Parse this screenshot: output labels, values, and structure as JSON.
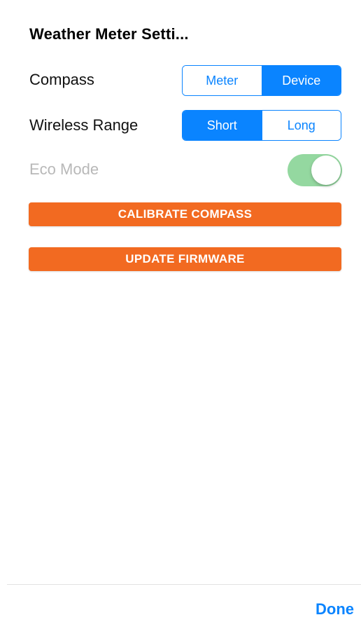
{
  "header": {
    "title": "Weather Meter Setti..."
  },
  "settings": {
    "compass": {
      "label": "Compass",
      "options": [
        "Meter",
        "Device"
      ],
      "selected": "Device"
    },
    "wireless_range": {
      "label": "Wireless Range",
      "options": [
        "Short",
        "Long"
      ],
      "selected": "Short"
    },
    "eco_mode": {
      "label": "Eco Mode",
      "enabled": true,
      "state": "disabled"
    }
  },
  "actions": {
    "calibrate_compass": "CALIBRATE COMPASS",
    "update_firmware": "UPDATE FIRMWARE"
  },
  "footer": {
    "done_label": "Done"
  },
  "colors": {
    "accent": "#0a84ff",
    "action_button": "#f26a21",
    "toggle_on_disabled": "#8fd69b",
    "disabled_text": "#b8b8b8"
  },
  "icons": {
    "eco_toggle": "toggle-switch-on-icon"
  }
}
